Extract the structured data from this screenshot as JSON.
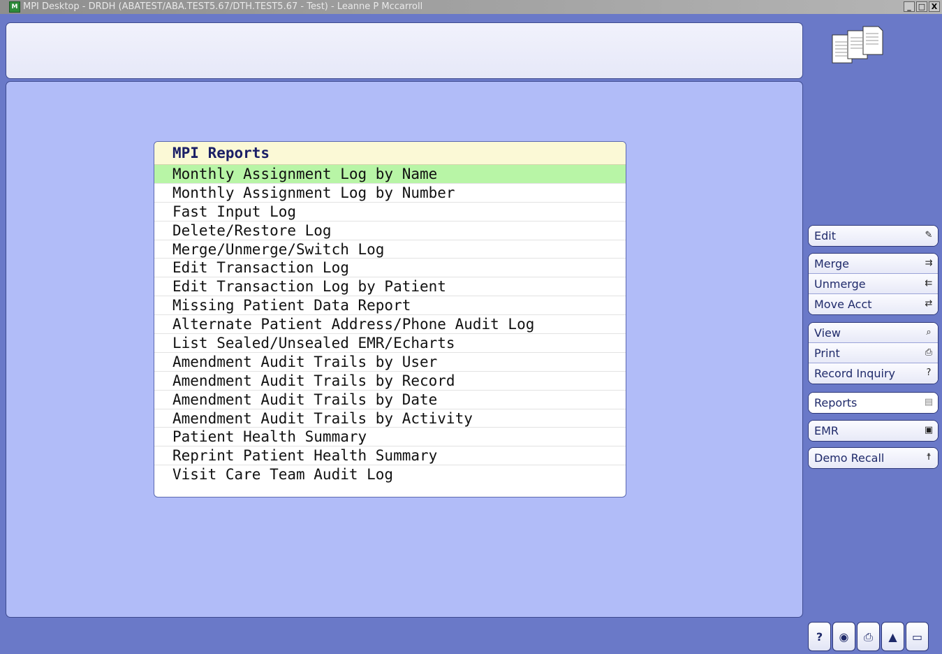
{
  "window": {
    "title": "MPI Desktop - DRDH (ABATEST/ABA.TEST5.67/DTH.TEST5.67 - Test) - Leanne P Mccarroll",
    "minimize_label": "_",
    "maximize_label": "□",
    "close_label": "X"
  },
  "reports": {
    "title": "MPI Reports",
    "items": [
      "Monthly Assignment Log by Name",
      "Monthly Assignment Log by Number",
      "Fast Input Log",
      "Delete/Restore Log",
      "Merge/Unmerge/Switch Log",
      "Edit Transaction Log",
      "Edit Transaction Log by Patient",
      "Missing Patient Data Report",
      "Alternate Patient Address/Phone Audit Log",
      "List Sealed/Unsealed EMR/Echarts",
      "Amendment Audit Trails by User",
      "Amendment Audit Trails by Record",
      "Amendment Audit Trails by Date",
      "Amendment Audit Trails by Activity",
      "Patient Health Summary",
      "Reprint Patient Health Summary",
      "Visit Care Team Audit Log"
    ],
    "selected_index": 0
  },
  "sidebar": {
    "edit": {
      "label": "Edit",
      "icon": "edit-icon"
    },
    "merge": {
      "label": "Merge",
      "icon": "merge-icon"
    },
    "unmerge": {
      "label": "Unmerge",
      "icon": "unmerge-icon"
    },
    "move_acct": {
      "label": "Move Acct",
      "icon": "move-acct-icon"
    },
    "view": {
      "label": "View",
      "icon": "view-icon"
    },
    "print": {
      "label": "Print",
      "icon": "print-icon"
    },
    "record_inquiry": {
      "label": "Record Inquiry",
      "icon": "record-inquiry-icon"
    },
    "reports": {
      "label": "Reports",
      "icon": "reports-icon"
    },
    "emr": {
      "label": "EMR",
      "icon": "emr-icon"
    },
    "demo_recall": {
      "label": "Demo Recall",
      "icon": "person-icon"
    }
  },
  "toolbar": {
    "help_label": "?"
  },
  "colors": {
    "background": "#6a79c8",
    "panel": "#b1bcf8",
    "selected_row": "#b8f5a6",
    "header_bg": "#fbf9d6"
  }
}
